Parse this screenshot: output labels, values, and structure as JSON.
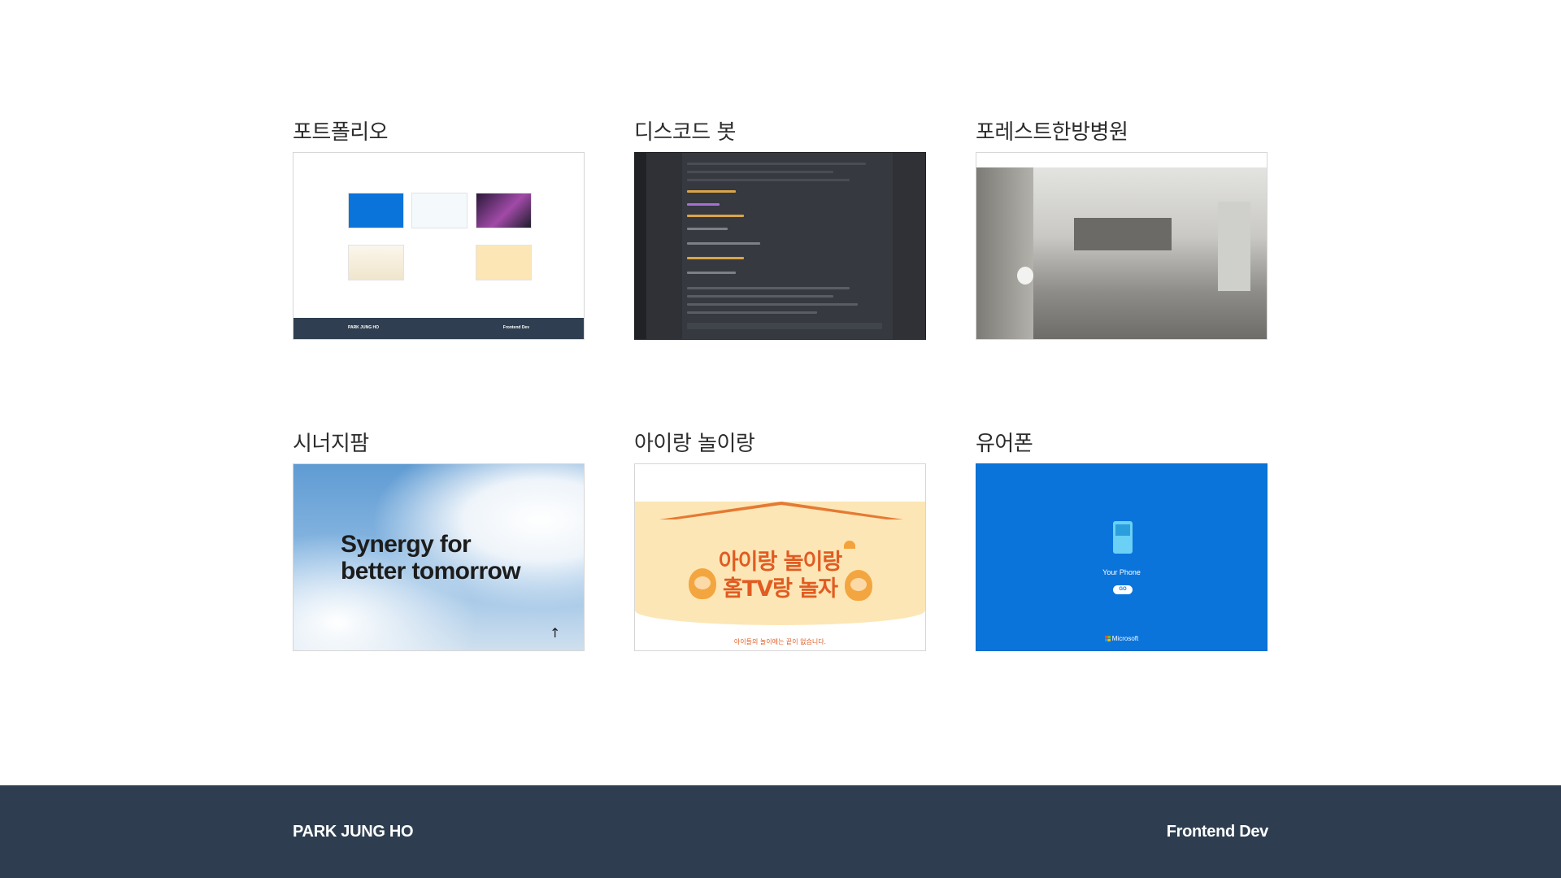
{
  "projects": [
    {
      "title": "포트폴리오",
      "thumb": {
        "footer_left": "PARK JUNG HO",
        "footer_right": "Frontend Dev"
      }
    },
    {
      "title": "디스코드 봇"
    },
    {
      "title": "포레스트한방병원"
    },
    {
      "title": "시너지팜",
      "thumb": {
        "headline_line1": "Synergy for",
        "headline_line2": "better tomorrow",
        "arrow": "↑"
      }
    },
    {
      "title": "아이랑 놀이랑",
      "thumb": {
        "line1": "아이랑 놀이랑",
        "line2": "홈TV랑 놀자",
        "bottom": "아이들의 놀이에는 끝이 없습니다."
      }
    },
    {
      "title": "유어폰",
      "thumb": {
        "label": "Your Phone",
        "button": "GO",
        "brand": "Microsoft"
      }
    }
  ],
  "footer": {
    "name": "PARK JUNG HO",
    "role": "Frontend Dev"
  },
  "colors": {
    "footer_bg": "#2e3e50",
    "title_text": "#2c2c2c",
    "yourphone_bg": "#0a74da",
    "hometv_accent": "#e05c22"
  }
}
